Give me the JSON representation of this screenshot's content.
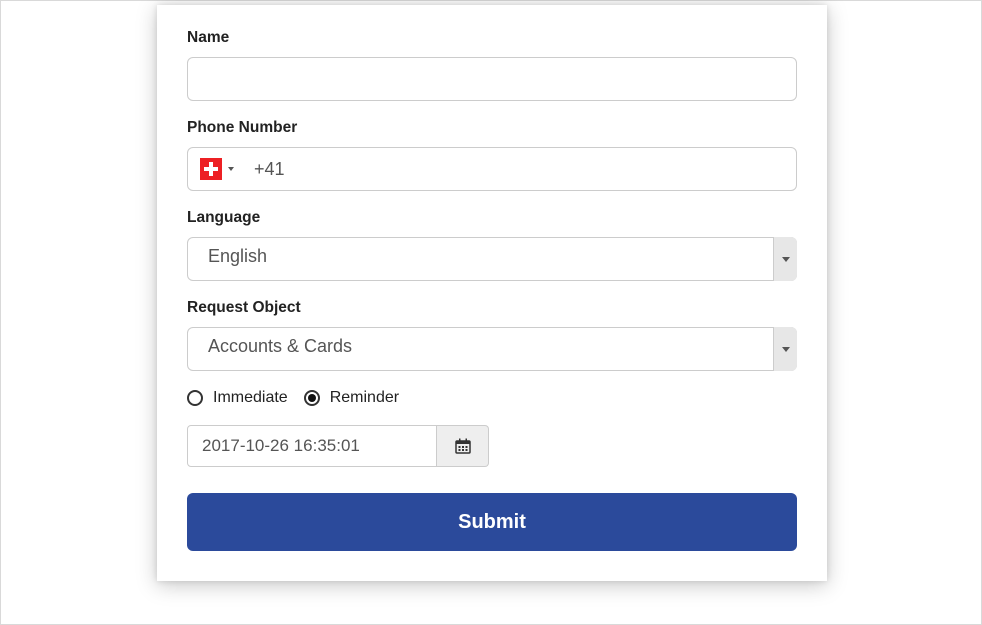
{
  "form": {
    "name": {
      "label": "Name",
      "value": ""
    },
    "phone": {
      "label": "Phone Number",
      "country": "CH",
      "dial_code": "+41"
    },
    "language": {
      "label": "Language",
      "selected": "English"
    },
    "request_object": {
      "label": "Request Object",
      "selected": "Accounts & Cards"
    },
    "timing_radios": {
      "immediate_label": "Immediate",
      "reminder_label": "Reminder",
      "selected": "reminder"
    },
    "datetime": {
      "value": "2017-10-26 16:35:01"
    },
    "submit_label": "Submit"
  }
}
